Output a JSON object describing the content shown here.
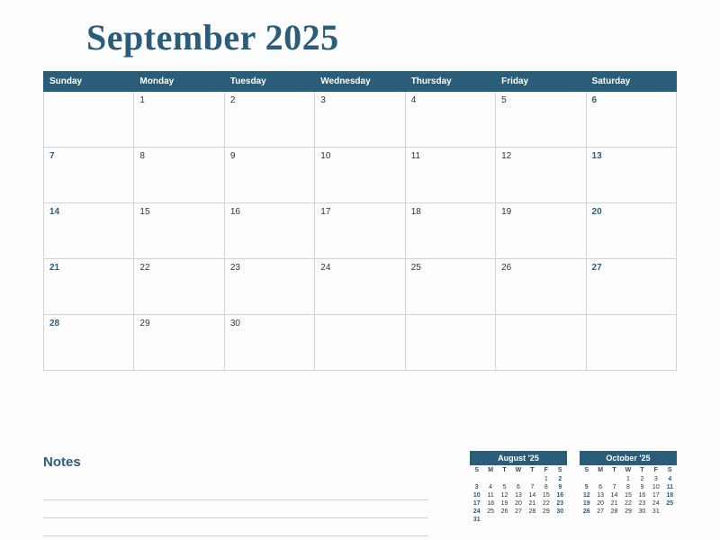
{
  "title": "September 2025",
  "day_headers": [
    "Sunday",
    "Monday",
    "Tuesday",
    "Wednesday",
    "Thursday",
    "Friday",
    "Saturday"
  ],
  "weeks": [
    [
      "",
      "1",
      "2",
      "3",
      "4",
      "5",
      "6"
    ],
    [
      "7",
      "8",
      "9",
      "10",
      "11",
      "12",
      "13"
    ],
    [
      "14",
      "15",
      "16",
      "17",
      "18",
      "19",
      "20"
    ],
    [
      "21",
      "22",
      "23",
      "24",
      "25",
      "26",
      "27"
    ],
    [
      "28",
      "29",
      "30",
      "",
      "",
      "",
      ""
    ]
  ],
  "notes_heading": "Notes",
  "mini_day_headers": [
    "S",
    "M",
    "T",
    "W",
    "T",
    "F",
    "S"
  ],
  "mini_prev": {
    "title": "August '25",
    "weeks": [
      [
        "",
        "",
        "",
        "",
        "",
        "1",
        "2"
      ],
      [
        "3",
        "4",
        "5",
        "6",
        "7",
        "8",
        "9"
      ],
      [
        "10",
        "11",
        "12",
        "13",
        "14",
        "15",
        "16"
      ],
      [
        "17",
        "18",
        "19",
        "20",
        "21",
        "22",
        "23"
      ],
      [
        "24",
        "25",
        "26",
        "27",
        "28",
        "29",
        "30"
      ],
      [
        "31",
        "",
        "",
        "",
        "",
        "",
        ""
      ]
    ]
  },
  "mini_next": {
    "title": "October '25",
    "weeks": [
      [
        "",
        "",
        "",
        "1",
        "2",
        "3",
        "4"
      ],
      [
        "5",
        "6",
        "7",
        "8",
        "9",
        "10",
        "11"
      ],
      [
        "12",
        "13",
        "14",
        "15",
        "16",
        "17",
        "18"
      ],
      [
        "19",
        "20",
        "21",
        "22",
        "23",
        "24",
        "25"
      ],
      [
        "26",
        "27",
        "28",
        "29",
        "30",
        "31",
        ""
      ]
    ]
  }
}
